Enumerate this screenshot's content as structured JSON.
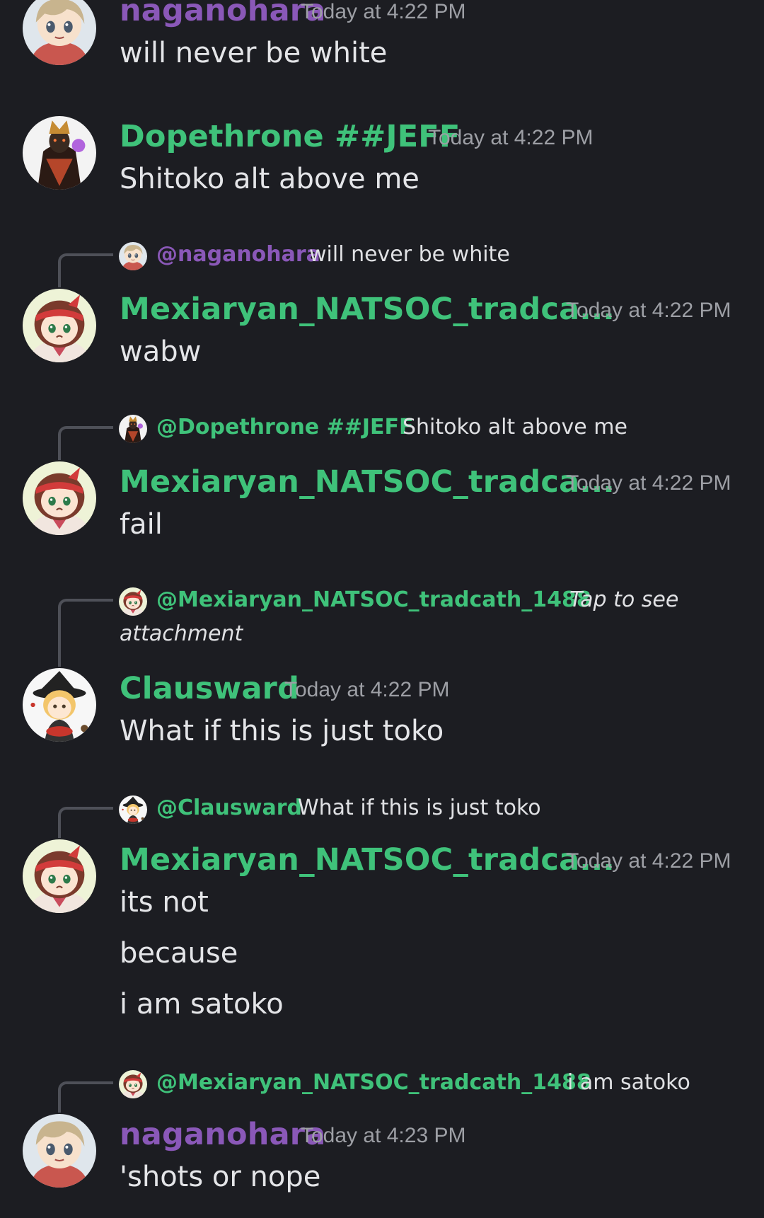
{
  "colors": {
    "background": "#1c1d22",
    "username_purple": "#8a58b8",
    "username_green": "#3fc27a",
    "timestamp": "#9d9fa5",
    "message_text": "#e4e5e8"
  },
  "messages": [
    {
      "author": "naganohara",
      "timestamp": "Today at 4:22 PM",
      "lines": [
        "will never be white"
      ],
      "avatar": "naganohara-avatar"
    },
    {
      "author": "Dopethrone ##JEFF",
      "timestamp": "Today at 4:22 PM",
      "lines": [
        "Shitoko alt above me"
      ],
      "avatar": "dopethrone-avatar"
    },
    {
      "reply": {
        "mention": "@naganohara",
        "text": "will never be white"
      },
      "author": "Mexiaryan_NATSOC_tradca...",
      "timestamp": "Today at 4:22 PM",
      "lines": [
        "wabw"
      ],
      "avatar": "mexiaryan-avatar"
    },
    {
      "reply": {
        "mention": "@Dopethrone ##JEFF",
        "text": "Shitoko alt above me"
      },
      "author": "Mexiaryan_NATSOC_tradca...",
      "timestamp": "Today at 4:22 PM",
      "lines": [
        "fail"
      ],
      "avatar": "mexiaryan-avatar"
    },
    {
      "reply": {
        "mention": "@Mexiaryan_NATSOC_tradcath_1488",
        "text_line1": "Tap to see",
        "text_line2": "attachment"
      },
      "author": "Clausward",
      "timestamp": "Today at 4:22 PM",
      "lines": [
        "What if this is just toko"
      ],
      "avatar": "clausward-avatar"
    },
    {
      "reply": {
        "mention": "@Clausward",
        "text": "What if this is just toko"
      },
      "author": "Mexiaryan_NATSOC_tradca...",
      "timestamp": "Today at 4:22 PM",
      "lines": [
        "its not",
        "because",
        "i am satoko"
      ],
      "avatar": "mexiaryan-avatar"
    },
    {
      "reply": {
        "mention": "@Mexiaryan_NATSOC_tradcath_1488",
        "text": "i am satoko"
      },
      "author": "naganohara",
      "timestamp": "Today at 4:23 PM",
      "lines": [
        "'shots or nope"
      ],
      "avatar": "naganohara-avatar"
    }
  ]
}
